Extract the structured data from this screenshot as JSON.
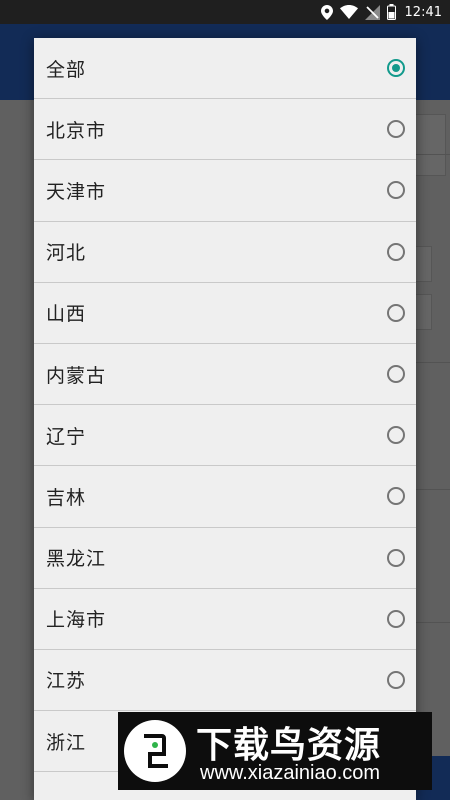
{
  "status_bar": {
    "time": "12:41",
    "icons": [
      "location-icon",
      "wifi-icon",
      "no-signal-icon",
      "battery-icon"
    ]
  },
  "dialog": {
    "selected_index": 0,
    "options": [
      {
        "label": "全部"
      },
      {
        "label": "北京市"
      },
      {
        "label": "天津市"
      },
      {
        "label": "河北"
      },
      {
        "label": "山西"
      },
      {
        "label": "内蒙古"
      },
      {
        "label": "辽宁"
      },
      {
        "label": "吉林"
      },
      {
        "label": "黑龙江"
      },
      {
        "label": "上海市"
      },
      {
        "label": "江苏"
      },
      {
        "label": "浙江"
      }
    ]
  },
  "watermark": {
    "title": "下载鸟资源",
    "url": "www.xiazainiao.com"
  },
  "colors": {
    "radio_accent": "#129a8c",
    "app_blue": "#2f6bd6"
  }
}
